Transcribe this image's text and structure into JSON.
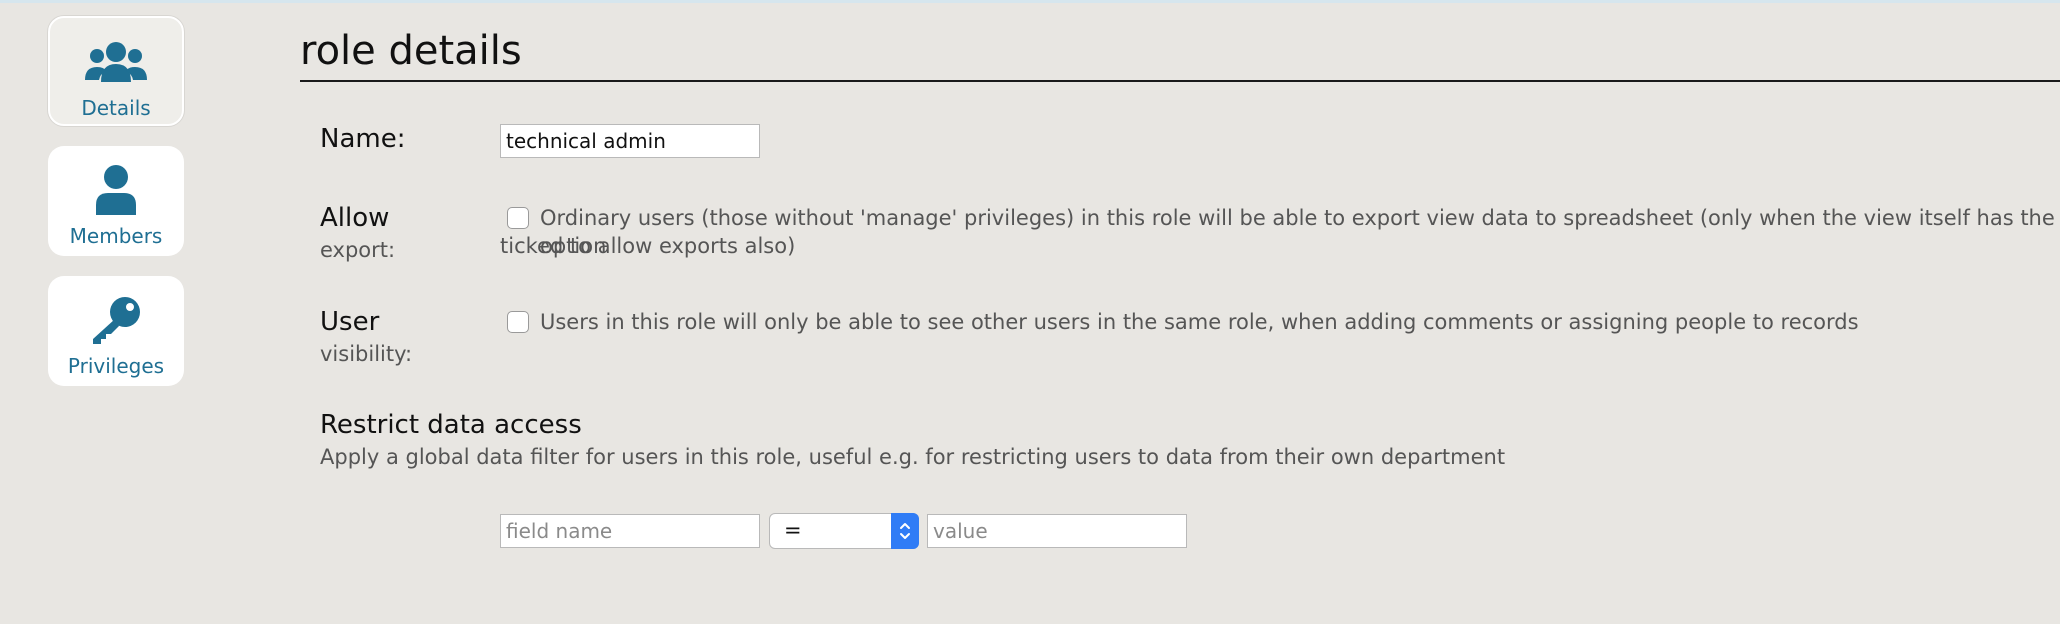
{
  "sidebar": {
    "items": [
      {
        "label": "Details",
        "icon": "users-group-icon",
        "active": true
      },
      {
        "label": "Members",
        "icon": "user-icon",
        "active": false
      },
      {
        "label": "Privileges",
        "icon": "key-icon",
        "active": false
      }
    ]
  },
  "page": {
    "title": "role details"
  },
  "form": {
    "name": {
      "label": "Name:",
      "value": "technical admin"
    },
    "allow_export": {
      "label": "Allow",
      "sublabel": "export:",
      "checked": false,
      "description_line1": "Ordinary users (those without 'manage' privileges) in this role will be able to export view data to spreadsheet (only when the view itself has the option",
      "description_line2": "ticked to allow exports also)"
    },
    "user_visibility": {
      "label": "User",
      "sublabel": "visibility:",
      "checked": false,
      "description": "Users in this role will only be able to see other users in the same role, when adding comments or assigning people to records"
    },
    "restrict": {
      "title": "Restrict data access",
      "description": "Apply a global data filter for users in this role, useful e.g. for restricting users to data from their own department",
      "field_placeholder": "field name",
      "operator": "=",
      "value_placeholder": "value"
    }
  },
  "colors": {
    "accent": "#1f6f93",
    "background": "#e8e6e2",
    "select_arrow": "#2f7cf6"
  }
}
